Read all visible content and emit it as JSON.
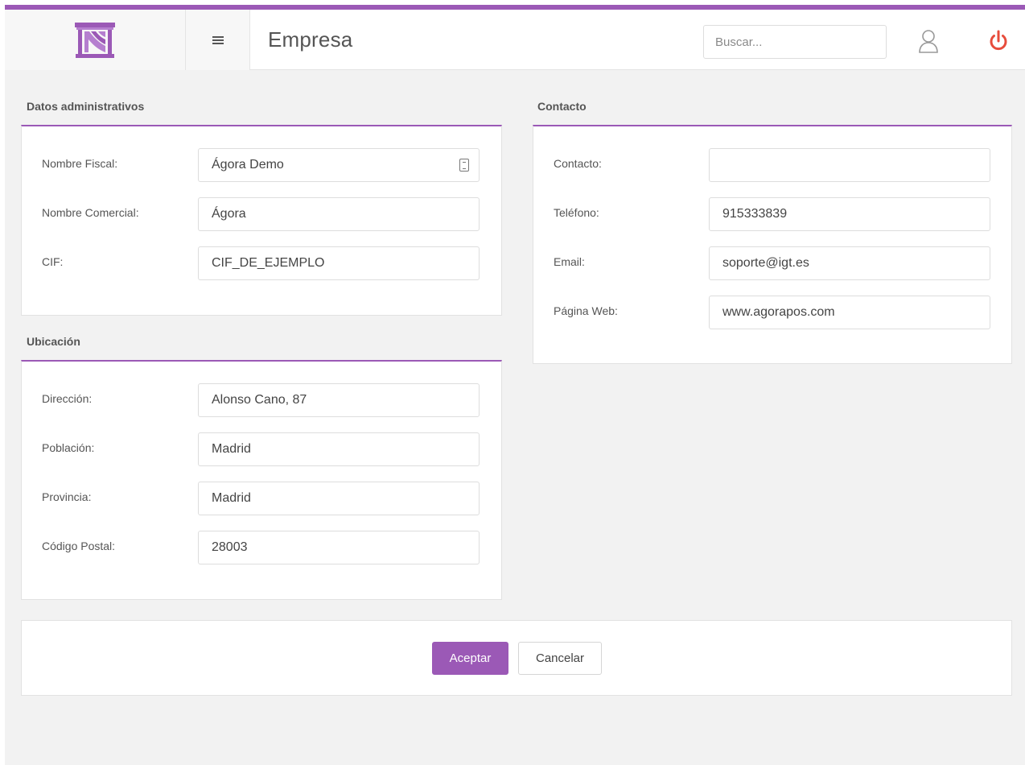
{
  "header": {
    "title": "Empresa",
    "search_placeholder": "Buscar...",
    "logo_icon": "columns-logo",
    "menu_icon": "hamburger-icon",
    "user_icon": "user-icon",
    "power_icon": "power-icon"
  },
  "colors": {
    "accent": "#9b59b6",
    "power": "#e74c3c",
    "background": "#f2f2f2"
  },
  "admin": {
    "title": "Datos administrativos",
    "fields": [
      {
        "label": "Nombre Fiscal:",
        "value": "Ágora Demo"
      },
      {
        "label": "Nombre Comercial:",
        "value": "Ágora"
      },
      {
        "label": "CIF:",
        "value": "CIF_DE_EJEMPLO"
      }
    ]
  },
  "location": {
    "title": "Ubicación",
    "fields": [
      {
        "label": "Dirección:",
        "value": "Alonso Cano, 87"
      },
      {
        "label": "Población:",
        "value": "Madrid"
      },
      {
        "label": "Provincia:",
        "value": "Madrid"
      },
      {
        "label": "Código Postal:",
        "value": "28003"
      }
    ]
  },
  "contact": {
    "title": "Contacto",
    "fields": [
      {
        "label": "Contacto:",
        "value": ""
      },
      {
        "label": "Teléfono:",
        "value": "915333839"
      },
      {
        "label": "Email:",
        "value": "soporte@igt.es"
      },
      {
        "label": "Página Web:",
        "value": "www.agorapos.com"
      }
    ]
  },
  "actions": {
    "accept": "Aceptar",
    "cancel": "Cancelar"
  }
}
